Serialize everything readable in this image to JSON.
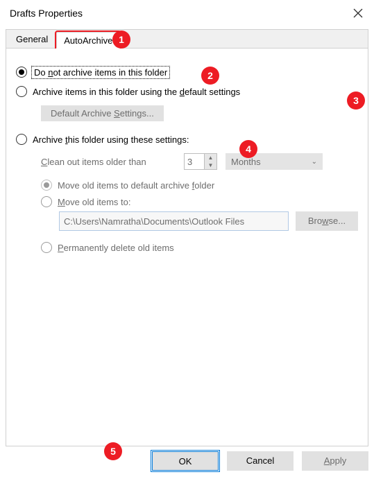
{
  "window": {
    "title": "Drafts Properties"
  },
  "tabs": {
    "general": "General",
    "autoarchive": "AutoArchive"
  },
  "opt1": {
    "text_pre": "Do ",
    "u": "n",
    "text_post": "ot archive items in this folder"
  },
  "opt2": {
    "text_pre": "Archive items in this folder using the ",
    "u": "d",
    "text_post": "efault settings"
  },
  "defaultBtn": {
    "pre": "Default Archive ",
    "u": "S",
    "post": "ettings..."
  },
  "opt3": {
    "text_pre": "Archive ",
    "u": "t",
    "text_post": "his folder using these settings:"
  },
  "cleanLabel": {
    "u": "C",
    "post": "lean out items older than"
  },
  "clean_value": "3",
  "period": "Months",
  "moveDefault": {
    "pre": "Move old items to default archive ",
    "u": "f",
    "post": "older"
  },
  "moveTo": {
    "u": "M",
    "post": "ove old items to:"
  },
  "path_value": "C:\\Users\\Namratha\\Documents\\Outlook Files",
  "browseBtn": {
    "pre": "Bro",
    "u": "w",
    "post": "se..."
  },
  "permDel": {
    "u": "P",
    "post": "ermanently delete old items"
  },
  "buttons": {
    "ok": "OK",
    "cancel": "Cancel",
    "apply": {
      "u": "A",
      "post": "pply"
    }
  },
  "callouts": {
    "c1": "1",
    "c2": "2",
    "c3": "3",
    "c4": "4",
    "c5": "5"
  }
}
